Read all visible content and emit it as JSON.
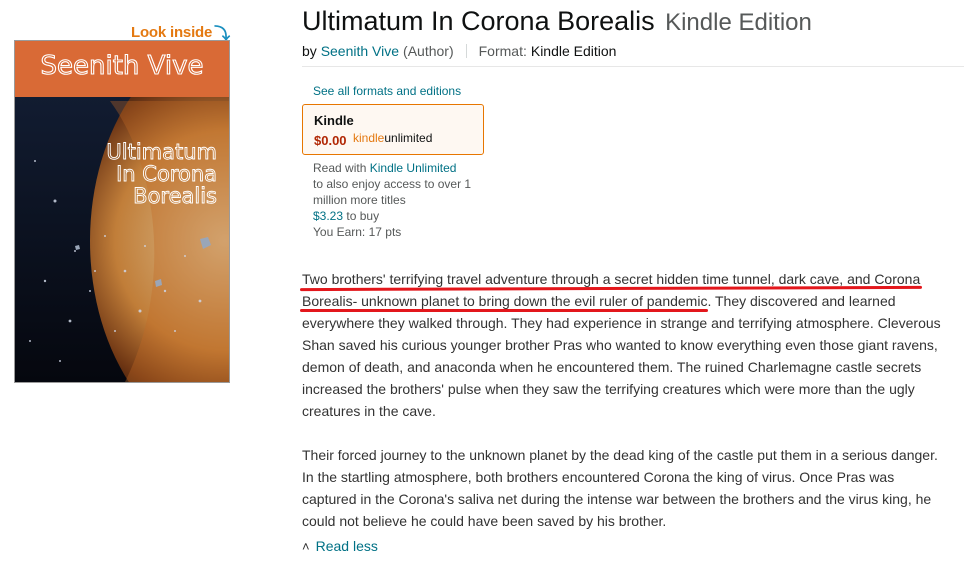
{
  "look_inside": {
    "label": "Look inside",
    "arrow_icon": "arrow-down-icon"
  },
  "cover": {
    "author_text": "Seenith Vive",
    "title_lines": [
      "Ultimatum",
      "In Corona",
      "Borealis"
    ],
    "band_color": "#d96a36"
  },
  "product": {
    "title": "Ultimatum In Corona Borealis",
    "edition": "Kindle Edition",
    "by_label": "by",
    "author": "Seenith Vive",
    "author_role": "(Author)",
    "format_label": "Format:",
    "format_value": "Kindle Edition"
  },
  "formats": {
    "see_all": "See all formats and editions",
    "kindle": {
      "name": "Kindle",
      "price": "$0.00",
      "ku_part1": "kindle",
      "ku_part2": "unlimited"
    },
    "ku_info": {
      "line1_prefix": "Read with",
      "line1_link": "Kindle Unlimited",
      "line2": "to also enjoy access to over 1 million more titles",
      "buy_price": "$3.23",
      "buy_suffix": "to buy",
      "earn": "You Earn: 17 pts"
    }
  },
  "description": {
    "paragraphs": [
      "Two brothers' terrifying travel adventure through a secret hidden time tunnel, dark cave, and Corona Borealis- unknown planet to bring down the evil ruler of pandemic. They discovered and learned everywhere they walked through. They had experience in strange and terrifying atmosphere. Cleverous Shan saved his curious younger brother Pras who wanted to know everything even those giant ravens, demon of death, and anaconda when he encountered them. The ruined Charlemagne castle secrets increased the brothers' pulse when they saw the terrifying creatures which were more than the ugly creatures in the cave.",
      "Their forced journey to the unknown planet by the dead king of the castle put them in a serious danger. In the startling atmosphere, both brothers encountered Corona the king of virus. Once Pras was captured in the Corona's saliva net during the intense war between the brothers and the virus king, he could not believe he could have been saved by his brother."
    ],
    "read_less": "Read less",
    "highlight_color": "#e3171c"
  }
}
